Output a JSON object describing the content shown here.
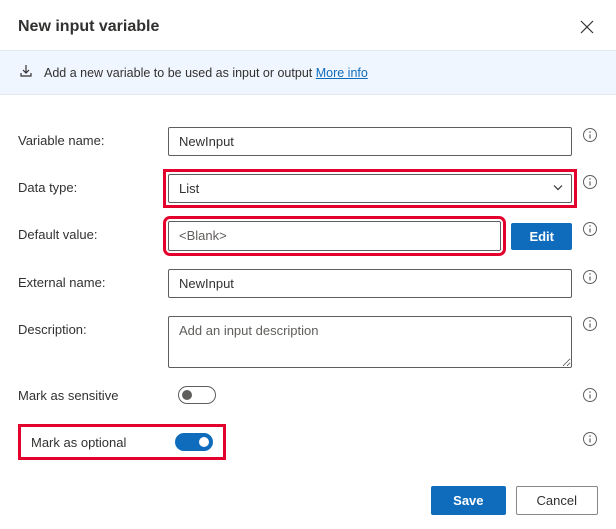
{
  "dialog": {
    "title": "New input variable",
    "banner_text": "Add a new variable to be used as input or output",
    "banner_link": "More info"
  },
  "fields": {
    "variable_name": {
      "label": "Variable name:",
      "value": "NewInput"
    },
    "data_type": {
      "label": "Data type:",
      "value": "List"
    },
    "default_value": {
      "label": "Default value:",
      "value": "<Blank>",
      "edit_label": "Edit"
    },
    "external_name": {
      "label": "External name:",
      "value": "NewInput"
    },
    "description": {
      "label": "Description:",
      "placeholder": "Add an input description",
      "value": ""
    },
    "mark_sensitive": {
      "label": "Mark as sensitive",
      "on": false
    },
    "mark_optional": {
      "label": "Mark as optional",
      "on": true
    }
  },
  "footer": {
    "save": "Save",
    "cancel": "Cancel"
  },
  "colors": {
    "accent": "#0f6cbd",
    "highlight": "#e3002d"
  }
}
